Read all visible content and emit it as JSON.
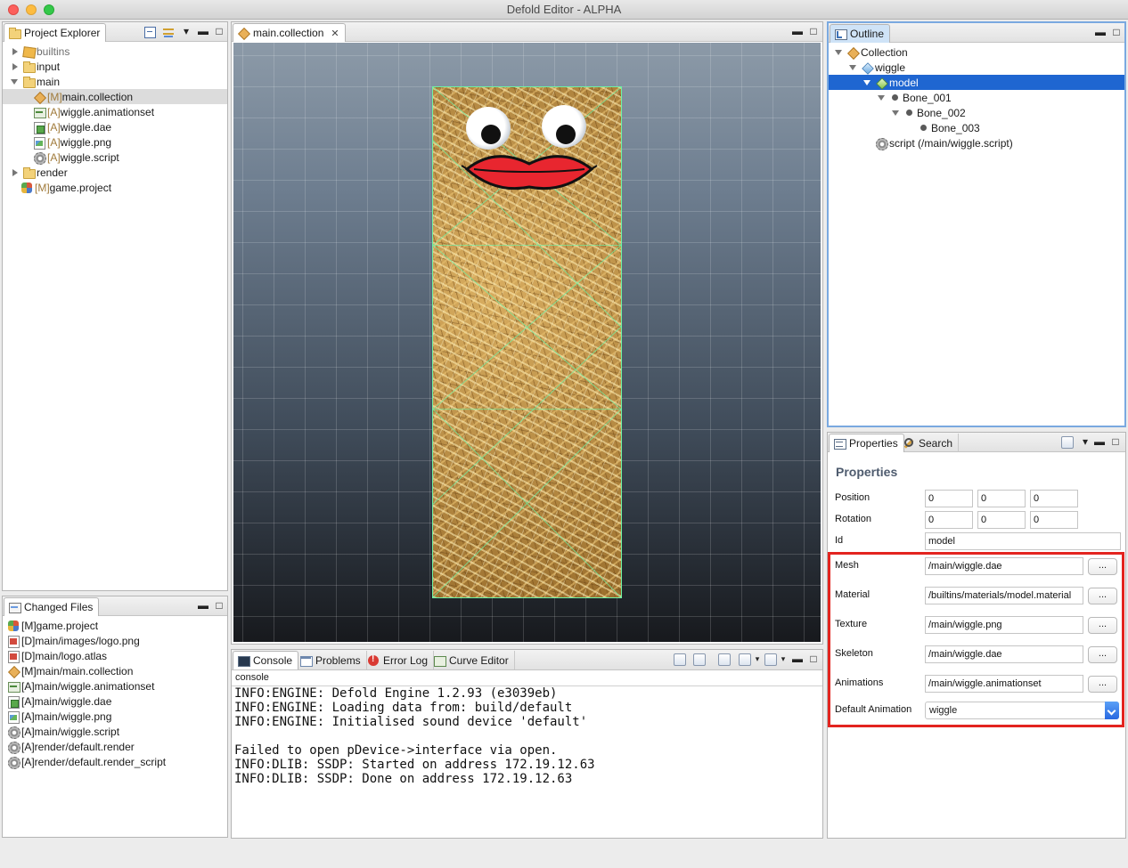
{
  "window": {
    "title": "Defold Editor - ALPHA"
  },
  "project_explorer": {
    "tab_label": "Project Explorer",
    "items": [
      {
        "prefix": "",
        "name": "builtins",
        "dim": true
      },
      {
        "prefix": "",
        "name": "input",
        "dim": false
      },
      {
        "prefix": "",
        "name": "main",
        "dim": false
      },
      {
        "prefix": "[M]",
        "name": "main.collection",
        "dim": false
      },
      {
        "prefix": "[A]",
        "name": "wiggle.animationset",
        "dim": false
      },
      {
        "prefix": "[A]",
        "name": "wiggle.dae",
        "dim": false
      },
      {
        "prefix": "[A]",
        "name": "wiggle.png",
        "dim": false
      },
      {
        "prefix": "[A]",
        "name": "wiggle.script",
        "dim": false
      },
      {
        "prefix": "",
        "name": "render",
        "dim": false
      },
      {
        "prefix": "[M]",
        "name": "game.project",
        "dim": false
      }
    ]
  },
  "changed_files": {
    "tab_label": "Changed Files",
    "items": [
      "[M]game.project",
      "[D]main/images/logo.png",
      "[D]main/logo.atlas",
      "[M]main/main.collection",
      "[A]main/wiggle.animationset",
      "[A]main/wiggle.dae",
      "[A]main/wiggle.png",
      "[A]main/wiggle.script",
      "[A]render/default.render",
      "[A]render/default.render_script"
    ]
  },
  "editor": {
    "tab_label": "main.collection"
  },
  "bottom_tabs": {
    "console": "Console",
    "problems": "Problems",
    "error_log": "Error Log",
    "curve_editor": "Curve Editor"
  },
  "console": {
    "header": "console",
    "lines": [
      "INFO:ENGINE: Defold Engine 1.2.93 (e3039eb)",
      "INFO:ENGINE: Loading data from: build/default",
      "INFO:ENGINE: Initialised sound device 'default'",
      "",
      "Failed to open pDevice->interface via open.",
      "INFO:DLIB: SSDP: Started on address 172.19.12.63",
      "INFO:DLIB: SSDP: Done on address 172.19.12.63"
    ]
  },
  "outline": {
    "tab_label": "Outline",
    "items": [
      {
        "label": "Collection"
      },
      {
        "label": "wiggle"
      },
      {
        "label": "model"
      },
      {
        "label": "Bone_001"
      },
      {
        "label": "Bone_002"
      },
      {
        "label": "Bone_003"
      },
      {
        "label": "script (/main/wiggle.script)"
      }
    ]
  },
  "properties_panel": {
    "tab_properties": "Properties",
    "tab_search": "Search",
    "title": "Properties",
    "position_label": "Position",
    "position": [
      "0",
      "0",
      "0"
    ],
    "rotation_label": "Rotation",
    "rotation": [
      "0",
      "0",
      "0"
    ],
    "id_label": "Id",
    "id": "model",
    "mesh_label": "Mesh",
    "mesh": "/main/wiggle.dae",
    "material_label": "Material",
    "material": "/builtins/materials/model.material",
    "texture_label": "Texture",
    "texture": "/main/wiggle.png",
    "skeleton_label": "Skeleton",
    "skeleton": "/main/wiggle.dae",
    "animations_label": "Animations",
    "animations": "/main/wiggle.animationset",
    "default_animation_label": "Default Animation",
    "default_animation": "wiggle",
    "browse_label": "..."
  }
}
